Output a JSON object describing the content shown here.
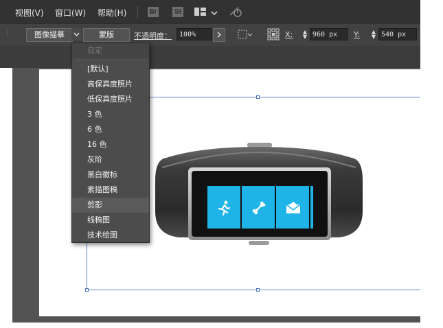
{
  "menubar": {
    "items": [
      "视图(V)",
      "窗口(W)",
      "帮助(H)"
    ],
    "badges": [
      "Br",
      "St"
    ]
  },
  "controlbar": {
    "preset": "图像描摹",
    "mask": "蒙版",
    "opacity_label": "不透明度：",
    "opacity_value": "100%",
    "x_label": "X:",
    "x_value": "960 px",
    "y_label": "Y:",
    "y_value": "540 px"
  },
  "dropdown": {
    "header": "自定",
    "items": [
      "[默认]",
      "高保真度照片",
      "低保真度照片",
      "3 色",
      "6 色",
      "16 色",
      "灰阶",
      "黑白徽标",
      "素描图稿",
      "剪影",
      "线稿图",
      "技术绘图"
    ],
    "highlighted": "剪影"
  },
  "colors": {
    "accent_guide": "#5b7fd6",
    "band_tile": "#1eb4e8"
  },
  "icons": [
    "layout-icon",
    "chevron-down-icon",
    "sync-icon",
    "chevron-right-icon",
    "transform-icon",
    "reference-point-icon",
    "running-icon",
    "dumbbell-icon",
    "mail-icon"
  ]
}
